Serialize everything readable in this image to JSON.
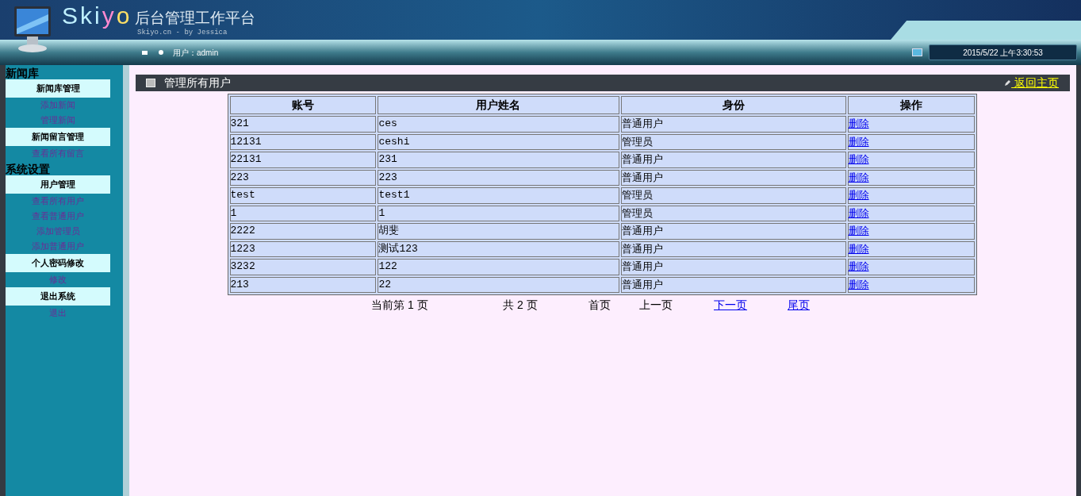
{
  "header": {
    "logo": "Skiyo",
    "title": "后台管理工作平台",
    "subtitle": "Skiyo.cn - by Jessica",
    "user": "用户：admin",
    "datetime": "2015/5/22 上午3:30:53"
  },
  "sidebar": [
    {
      "heading": "新闻库",
      "groups": [
        {
          "title": "新闻库管理",
          "links": [
            "添加新闻",
            "管理新闻"
          ]
        },
        {
          "title": "新闻留言管理",
          "links": [
            "查看所有留言"
          ]
        }
      ]
    },
    {
      "heading": "系统设置",
      "groups": [
        {
          "title": "用户管理",
          "links": [
            "查看所有用户",
            "查看普通用户",
            "添加管理员",
            "添加普通用户"
          ]
        },
        {
          "title": "个人密码修改",
          "links": [
            "修改"
          ]
        },
        {
          "title": "退出系统",
          "links": [
            "退出"
          ]
        }
      ]
    }
  ],
  "page_title": "管理所有用户",
  "home_link": " 返回主页",
  "table": {
    "columns": [
      "账号",
      "用户姓名",
      "身份",
      "操作"
    ],
    "rows": [
      [
        "321",
        "ces",
        "普通用户",
        "删除"
      ],
      [
        "12131",
        "ceshi",
        "管理员",
        "删除"
      ],
      [
        "22131",
        "231",
        "普通用户",
        "删除"
      ],
      [
        "223",
        "223",
        "普通用户",
        "删除"
      ],
      [
        "test",
        "test1",
        "管理员",
        "删除"
      ],
      [
        "1",
        "1",
        "管理员",
        "删除"
      ],
      [
        "2222",
        "胡斐",
        "普通用户",
        "删除"
      ],
      [
        "1223",
        "测试123",
        "普通用户",
        "删除"
      ],
      [
        "3232",
        "122",
        "普通用户",
        "删除"
      ],
      [
        "213",
        "22",
        "普通用户",
        "删除"
      ]
    ]
  },
  "pagination": [
    {
      "kind": "text",
      "label": "当前第 1 页"
    },
    {
      "kind": "text",
      "label": "共 2 页"
    },
    {
      "kind": "text",
      "label": "首页"
    },
    {
      "kind": "text",
      "label": "上一页"
    },
    {
      "kind": "link",
      "label": "下一页"
    },
    {
      "kind": "link",
      "label": "尾页"
    }
  ]
}
